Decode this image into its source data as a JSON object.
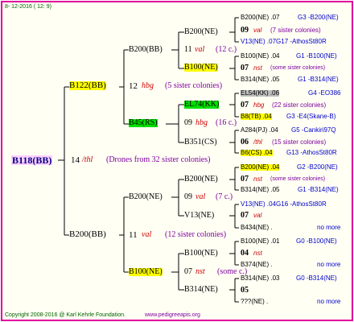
{
  "header": {
    "date": "8- 12-2016 ( 12:  9)"
  },
  "footer": {
    "copyright": "Copyright 2008-2016 @ Karl Kehrle Foundation.",
    "url": "www.pedigreeapis.org"
  },
  "root": {
    "label": "B118(BB)",
    "num": "14",
    "code": "/thl",
    "note": "(Drones from 32 sister colonies)"
  },
  "g1": [
    {
      "label": "B122(BB)",
      "num": "12",
      "code": "hbg",
      "note": "(5 sister colonies)"
    },
    {
      "label": "B200(BB)",
      "num": "11",
      "code": "val",
      "note": "(12 sister colonies)"
    }
  ],
  "g2": [
    {
      "label": "B200(BB)",
      "num": "11",
      "code": "val",
      "note": "(12 c.)"
    },
    {
      "label": "B45(RS)",
      "num": "09",
      "code": "hbg",
      "note": "(16 c.)"
    },
    {
      "label": "B200(NE)",
      "num": "09",
      "code": "val",
      "note": "(7 c.)"
    },
    {
      "label": "B100(NE)",
      "num": "07",
      "code": "nst",
      "note": "(some c.)"
    }
  ],
  "g3": [
    "B200(NE)",
    "B100(NE)",
    "EL74(KK)",
    "B351(CS)",
    "B200(NE)",
    "V13(NE)",
    "B100(NE)",
    "B314(NE)"
  ],
  "g4": [
    {
      "a": "B200(NE) .07",
      "b": "G3 -B200(NE)",
      "n": "09",
      "c": "val",
      "note": "(7 sister colonies)",
      "e": "V13(NE) .07G17 -AthosSt80R"
    },
    {
      "a": "B100(NE) .04",
      "b": "G1 -B100(NE)",
      "n": "07",
      "c": "nst",
      "note": "(some sister colonies)",
      "e": "B314(NE) .05",
      "f": "G1 -B314(NE)"
    },
    {
      "a": "EL54(KK) .06",
      "b": "G4 -EO386",
      "n": "07",
      "c": "hbg",
      "note": "(22 sister colonies)",
      "e": "B8(TB) .04",
      "f": "G3 -E4(Skane-B)"
    },
    {
      "a": "A284(PJ) .04",
      "b": "G5 -Cankiri97Q",
      "n": "06",
      "c": "/thl",
      "note": "(15 sister colonies)",
      "e": "B6(CS) .04",
      "f": "G13 -AthosSt80R"
    },
    {
      "a": "B200(NE) .04",
      "b": "G2 -B200(NE)",
      "n": "07",
      "c": "nst",
      "note": "(some sister colonies)",
      "e": "B314(NE) .05",
      "f": "G1 -B314(NE)"
    },
    {
      "a": "V13(NE) .04G16 -AthosSt80R",
      "n": "07",
      "c": "val",
      "e": "B434(NE) .",
      "f": "no more"
    },
    {
      "a": "B100(NE) .01",
      "b": "G0 -B100(NE)",
      "n": "04",
      "c": "nst",
      "e": "B374(NE) .",
      "f": "no more"
    },
    {
      "a": "B314(NE) .03",
      "b": "G0 -B314(NE)",
      "n": "05",
      "e": "???(NE) .",
      "f": "no more"
    }
  ]
}
